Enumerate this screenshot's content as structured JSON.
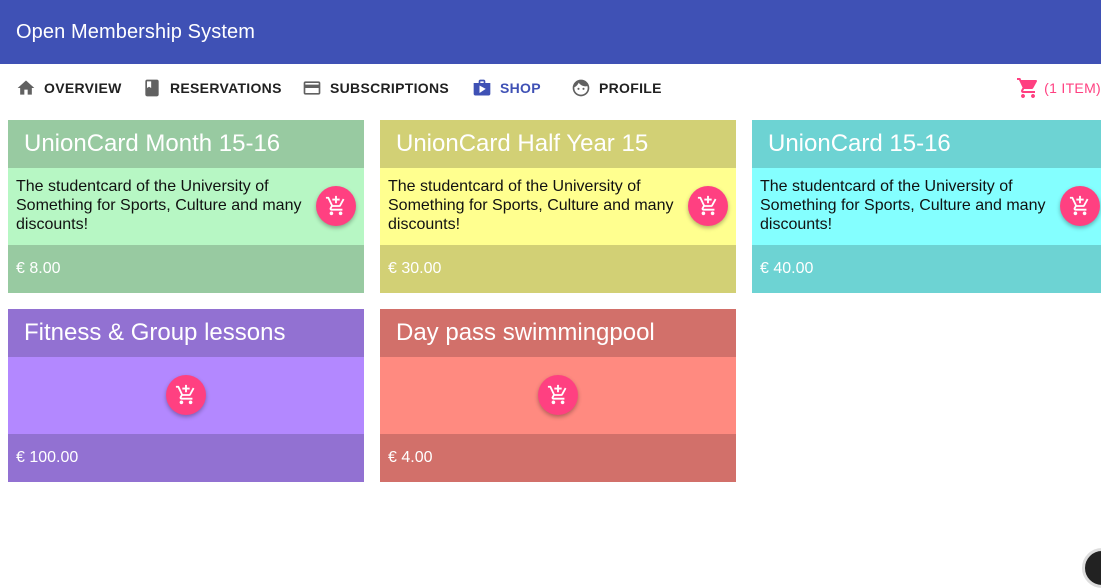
{
  "app": {
    "title": "Open Membership System"
  },
  "nav": {
    "items": [
      {
        "label": "OVERVIEW",
        "icon": "home-icon"
      },
      {
        "label": "RESERVATIONS",
        "icon": "book-icon"
      },
      {
        "label": "SUBSCRIPTIONS",
        "icon": "credit-card-icon"
      },
      {
        "label": "SHOP",
        "icon": "shop-icon",
        "active": true
      },
      {
        "label": "PROFILE",
        "icon": "face-icon"
      }
    ],
    "cart": {
      "label": "(1 ITEM)",
      "icon": "cart-icon"
    }
  },
  "colors": {
    "appbar": "#3f51b5",
    "accent": "#ff4081"
  },
  "products": [
    {
      "name": "UnionCard Month 15-16",
      "description": "The studentcard of the University of Something for Sports, Culture and many discounts!",
      "price": "€ 8.00"
    },
    {
      "name": "UnionCard Half Year 15",
      "description": "The studentcard of the University of Something for Sports, Culture and many discounts!",
      "price": "€ 30.00"
    },
    {
      "name": "UnionCard 15-16",
      "description": "The studentcard of the University of Something for Sports, Culture and many discounts!",
      "price": "€ 40.00"
    },
    {
      "name": "Fitness & Group lessons",
      "description": "",
      "price": "€ 100.00"
    },
    {
      "name": "Day pass swimmingpool",
      "description": "",
      "price": "€ 4.00"
    }
  ]
}
